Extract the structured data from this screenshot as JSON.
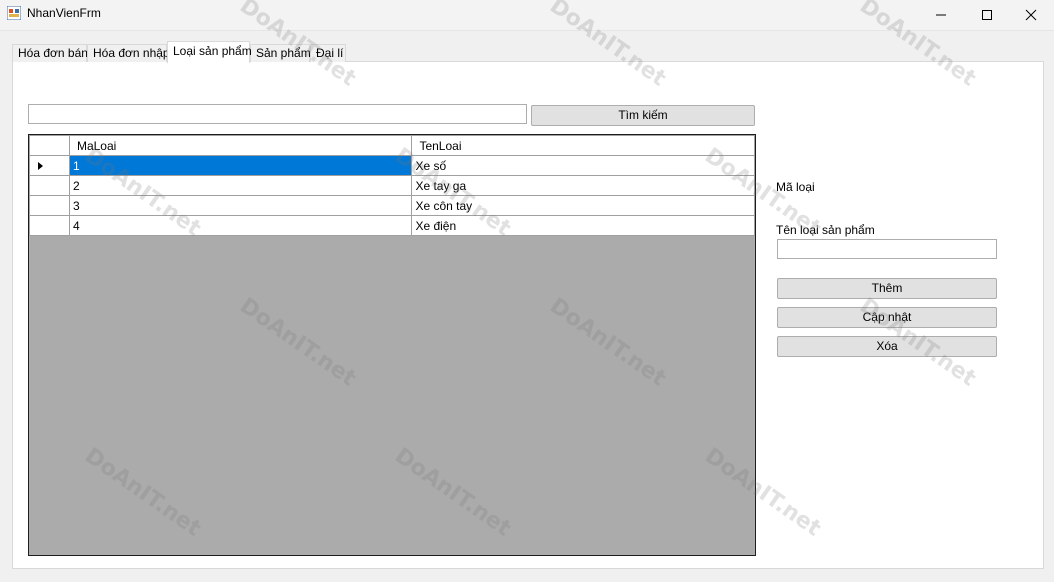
{
  "window": {
    "title": "NhanVienFrm",
    "controls": [
      "minimize-icon",
      "maximize-icon",
      "close-icon"
    ]
  },
  "tabs": [
    {
      "label": "Hóa đơn bán",
      "active": false
    },
    {
      "label": "Hóa đơn nhập",
      "active": false
    },
    {
      "label": "Loại sản phẩm",
      "active": true
    },
    {
      "label": "Sản phẩm",
      "active": false
    },
    {
      "label": "Đại lí",
      "active": false
    }
  ],
  "search": {
    "value": "",
    "button_label": "Tìm kiếm"
  },
  "grid": {
    "columns": [
      "MaLoai",
      "TenLoai"
    ],
    "rows": [
      {
        "MaLoai": "1",
        "TenLoai": "Xe số",
        "selected": true
      },
      {
        "MaLoai": "2",
        "TenLoai": "Xe tay ga",
        "selected": false
      },
      {
        "MaLoai": "3",
        "TenLoai": "Xe côn tay",
        "selected": false
      },
      {
        "MaLoai": "4",
        "TenLoai": "Xe điện",
        "selected": false
      }
    ]
  },
  "form": {
    "ma_loai_label": "Mã loại",
    "ten_loai_label": "Tên loại sản phẩm",
    "ten_loai_value": "",
    "add_label": "Thêm",
    "update_label": "Cập nhật",
    "delete_label": "Xóa"
  },
  "watermark": {
    "text": "DoAnIT.net"
  },
  "colors": {
    "selection": "#0078d7",
    "grid_background": "#ababab",
    "window_bg": "#f0f0f0"
  }
}
